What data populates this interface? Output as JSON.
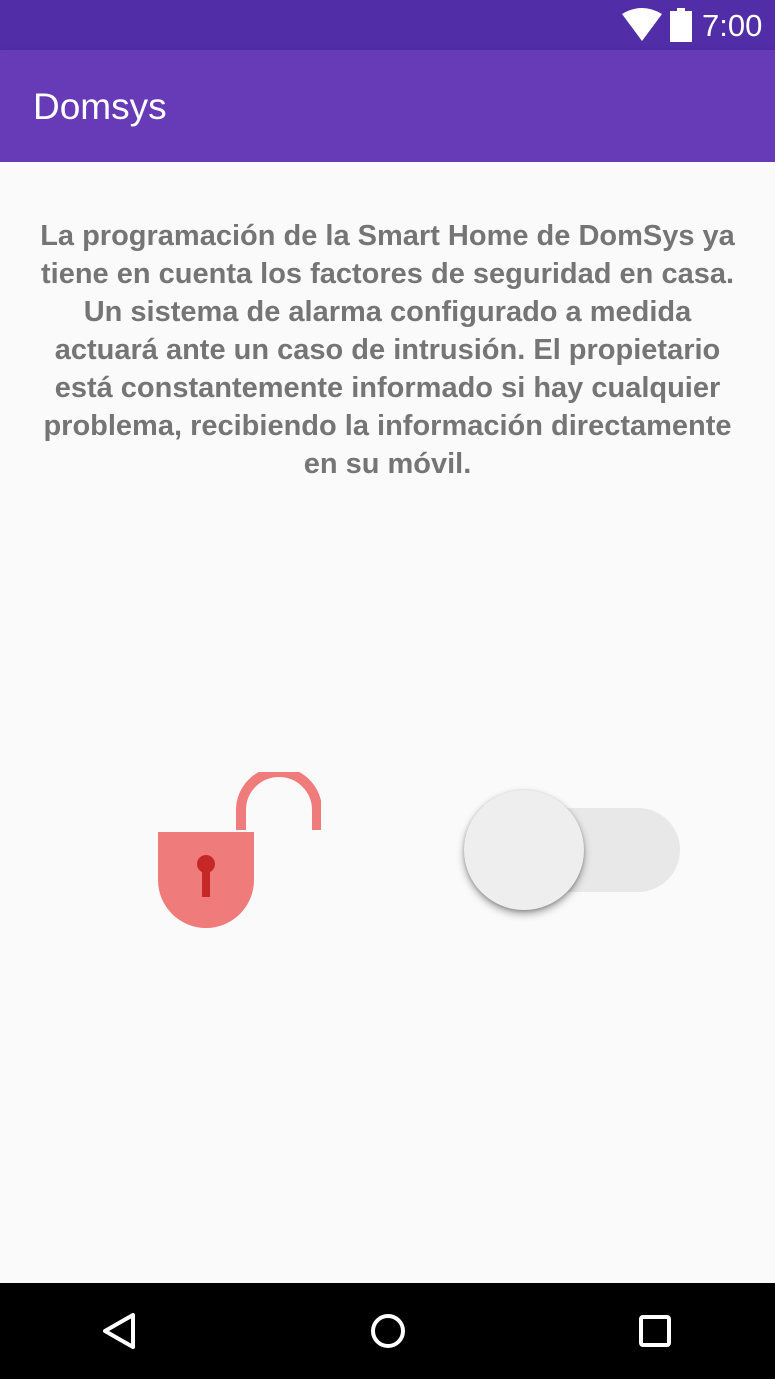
{
  "status_bar": {
    "time": "7:00",
    "icons": [
      "wifi-icon",
      "battery-icon"
    ]
  },
  "app_bar": {
    "title": "Domsys"
  },
  "main": {
    "description": "La programación de la Smart Home de DomSys ya tiene en cuenta los factores de seguridad en casa. Un sistema de alarma configurado a medida actuará ante un caso de intrusión. El propietario está constantemente informado si hay cualquier problema, recibiendo la información directamente en su móvil.",
    "lock_icon": "unlocked-padlock-icon",
    "alarm_switch": {
      "checked": false
    }
  },
  "nav_bar": {
    "icons": [
      "back-icon",
      "home-icon",
      "recents-icon"
    ]
  },
  "colors": {
    "status_bar": "#512da8",
    "app_bar": "#673ab7",
    "background": "#fafafa",
    "text": "#757575",
    "lock_body": "#ef7b7b",
    "lock_keyhole": "#c62828",
    "switch_track": "#e8e8e8",
    "switch_thumb": "#eeeeee",
    "nav_bar": "#000000"
  }
}
